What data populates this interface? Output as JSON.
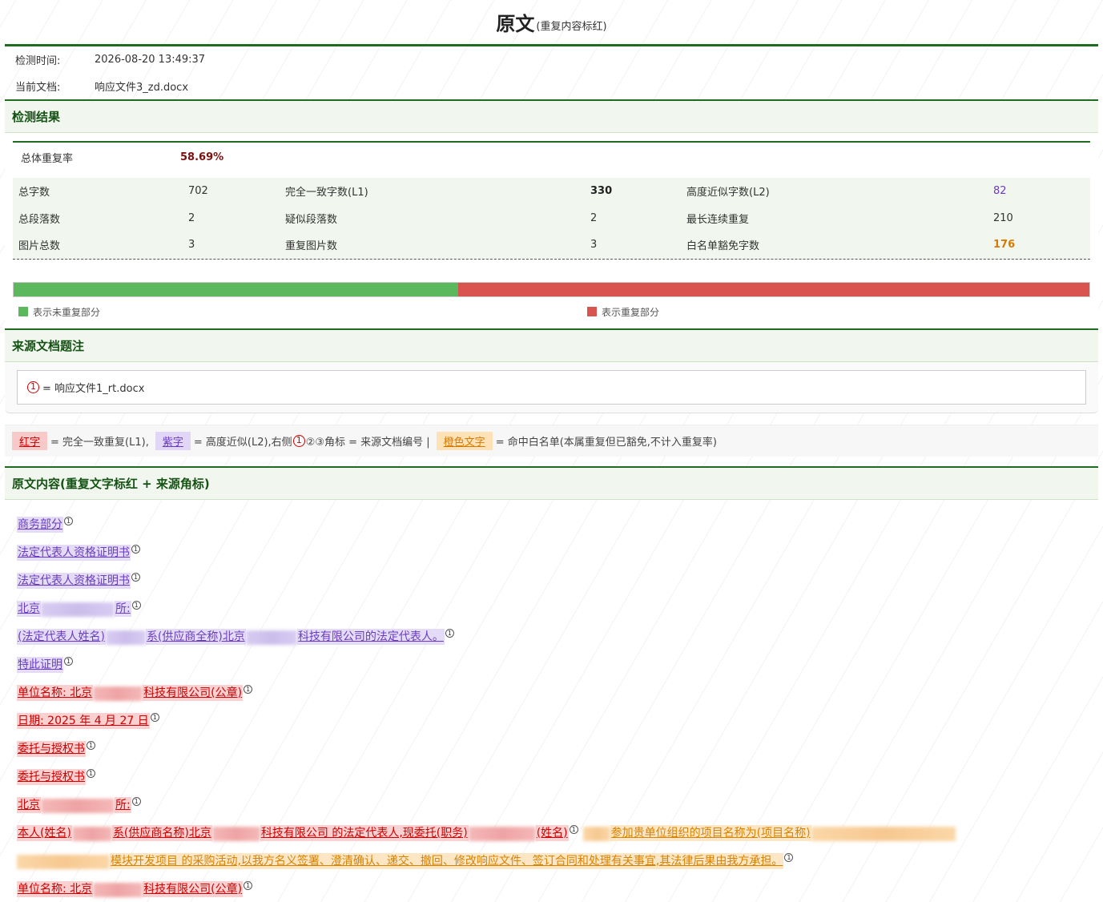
{
  "header": {
    "title": "原文",
    "subtitle": "(重复内容标红)"
  },
  "meta": {
    "time_label": "检测时间:",
    "time_value": "2026-08-20 13:49:37",
    "doc_label": "当前文档:",
    "doc_value": "响应文件3_zd.docx"
  },
  "results": {
    "heading": "检测结果",
    "rate_label": "总体重复率",
    "rate_value": "58.69%",
    "rows": [
      {
        "l1": "总字数",
        "v1": "702",
        "l2": "完全一致字数(L1)",
        "v2": "330",
        "l3": "高度近似字数(L2)",
        "v3": "82"
      },
      {
        "l1": "总段落数",
        "v1": "2",
        "l2": "疑似段落数",
        "v2": "2",
        "l3": "最长连续重复",
        "v3": "210"
      },
      {
        "l1": "图片总数",
        "v1": "3",
        "l2": "重复图片数",
        "v2": "3",
        "l3": "白名单豁免字数",
        "v3": "176"
      }
    ],
    "bar": {
      "non_duplicate_fraction": 0.4131,
      "duplicate_fraction": 0.5869
    },
    "legend_green": "表示未重复部分",
    "legend_red": "表示重复部分"
  },
  "colors": {
    "green": "#5cb85c",
    "red": "#d9534f",
    "purple": "#6a3cbf",
    "orange": "#d97a00",
    "brand": "#1f6b1f"
  },
  "sources": {
    "heading": "来源文档题注",
    "marker": "1",
    "text": "= 响应文件1_rt.docx"
  },
  "legend_line": {
    "red_tag": "红字",
    "red_desc": "= 完全一致重复(L1),",
    "purple_tag": "紫字",
    "purple_desc": "= 高度近似(L2),右侧",
    "marker": "1",
    "mid_desc": "②③角标 = 来源文档编号 |",
    "orange_tag": "橙色文字",
    "orange_desc": "= 命中白名单(本属重复但已豁免,不计入重复率)"
  },
  "content": {
    "heading": "原文内容(重复文字标红 + 来源角标)",
    "paragraphs": {
      "p1": "商务部分",
      "p2": "法定代表人资格证明书",
      "p3": "法定代表人资格证明书",
      "p4a": "北京",
      "p4b": "所:",
      "p5a": "(法定代表人姓名)",
      "p5b": "系(供应商全称)北京",
      "p5c": "科技有限公司的法定代表人。",
      "p6": "特此证明",
      "p7a": "单位名称: 北京",
      "p7b": "科技有限公司(公章)",
      "p8": "日期: 2025 年 4 月 27 日",
      "p9": "委托与授权书",
      "p10": "委托与授权书",
      "p11a": "北京",
      "p11b": "所:",
      "p12a": "本人(姓名)",
      "p12b": "系(供应商名称)北京",
      "p12c": "科技有限公司 的法定代表人,现委托(职务)",
      "p12d": "(姓名)",
      "p12e": "参加贵单位组织的项目名称为(项目名称)",
      "p13a": "模块开发项目 的采购活动,以我方名义签署、澄清确认、递交、撤回、修改响应文件、签订合同和处理有关事宜,其法律后果由我方承担。",
      "p14a": "单位名称: 北京",
      "p14b": "科技有限公司(公章)",
      "marker": "1"
    }
  }
}
